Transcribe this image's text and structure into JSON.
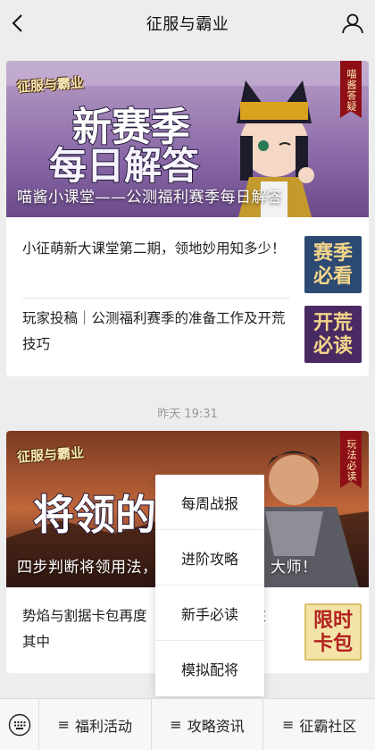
{
  "header": {
    "title": "征服与霸业",
    "back_icon": "back-arrow-icon",
    "profile_icon": "user-profile-icon"
  },
  "card1": {
    "cover": {
      "logo": "征服与霸业",
      "headline_line1": "新赛季",
      "headline_line2": "每日解答",
      "ribbon": "喵酱答疑",
      "caption": "喵酱小课堂——公测福利赛季每日解答"
    },
    "items": [
      {
        "title": "小征萌新大课堂第二期，领地妙用知多少！",
        "thumb": "赛季必看"
      },
      {
        "title": "玩家投稿｜公测福利赛季的准备工作及开荒技巧",
        "thumb": "开荒必读"
      }
    ]
  },
  "timestamp": "昨天 19:31",
  "card2": {
    "cover": {
      "logo": "征服与霸业",
      "headline": "将领的",
      "ribbon": "玩法必读",
      "caption": "四步判断将领用法，",
      "caption_tail": "大师！"
    },
    "items": [
      {
        "title": "势焰与割据卡包再度",
        "title_tail": "在",
        "title_line2": "其中",
        "thumb": "限时卡包"
      }
    ]
  },
  "popup_menu": {
    "items": [
      "每周战报",
      "进阶攻略",
      "新手必读",
      "模拟配将"
    ]
  },
  "bottom_menu": {
    "keyboard_icon": "keyboard-icon",
    "items": [
      "福利活动",
      "攻略资讯",
      "征霸社区"
    ],
    "menu_icon": "≡"
  },
  "colors": {
    "background": "#ededed",
    "ribbon_red": "#8e1016",
    "thumb_blue": "#2c4a73",
    "thumb_purple": "#4a2a63",
    "thumb_gold": "#b32020"
  }
}
